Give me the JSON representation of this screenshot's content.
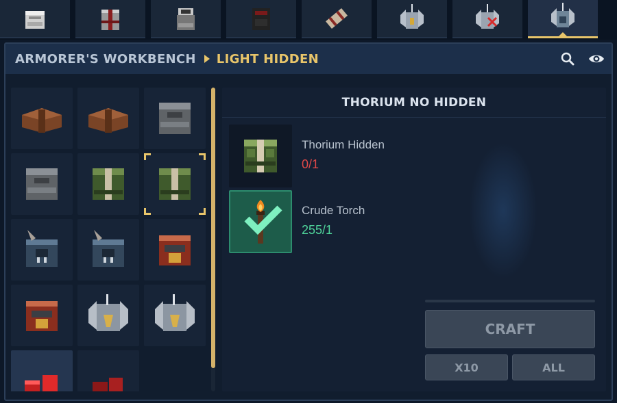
{
  "tabs": [
    {
      "name": "tab-chest-white",
      "icon": "white-armor-icon"
    },
    {
      "name": "tab-chest-red-trim",
      "icon": "red-trim-armor-icon"
    },
    {
      "name": "tab-chest-grey",
      "icon": "grey-armor-icon"
    },
    {
      "name": "tab-chest-dark",
      "icon": "dark-red-armor-icon"
    },
    {
      "name": "tab-scroll",
      "icon": "wrapped-scroll-icon"
    },
    {
      "name": "tab-winged-helm",
      "icon": "winged-helm-icon"
    },
    {
      "name": "tab-winged-helm-crossed",
      "icon": "winged-helm-crossed-icon"
    },
    {
      "name": "tab-winged-helm-active",
      "icon": "winged-helm-blue-icon",
      "active": true
    }
  ],
  "header": {
    "title": "ARMORER'S WORKBENCH",
    "subtitle": "LIGHT HIDDEN",
    "search_icon": "search-icon",
    "eye_icon": "eye-icon"
  },
  "recipes": [
    {
      "icon": "brown-leather-armor-icon",
      "color": "#8a5530"
    },
    {
      "icon": "brown-leather-armor-icon",
      "color": "#8a5530"
    },
    {
      "icon": "grey-plate-armor-icon",
      "color": "#6c7178"
    },
    {
      "icon": "grey-plate-armor-icon",
      "color": "#6c7178"
    },
    {
      "icon": "green-thorium-armor-icon",
      "color": "#4f6e3a"
    },
    {
      "icon": "green-thorium-armor-icon",
      "color": "#4f6e3a",
      "selected": true
    },
    {
      "icon": "blue-feathered-armor-icon",
      "color": "#3f566e"
    },
    {
      "icon": "blue-feathered-armor-icon",
      "color": "#3f566e"
    },
    {
      "icon": "red-gold-armor-icon",
      "color": "#9a3a28"
    },
    {
      "icon": "red-gold-armor-icon",
      "color": "#9a3a28"
    },
    {
      "icon": "silver-winged-armor-icon",
      "color": "#8c96a2"
    },
    {
      "icon": "silver-winged-armor-icon",
      "color": "#8c96a2"
    },
    {
      "icon": "red-boots-icon",
      "color": "#c02222",
      "hovered": true
    },
    {
      "icon": "red-boots-icon",
      "color": "#a01c1c"
    }
  ],
  "detail": {
    "title": "THORIUM NO HIDDEN",
    "ingredients": [
      {
        "name": "Thorium Hidden",
        "count": "0/1",
        "status": "missing",
        "icon": "green-thorium-armor-icon"
      },
      {
        "name": "Crude Torch",
        "count": "255/1",
        "status": "ok",
        "icon": "torch-icon"
      }
    ],
    "craft_label": "CRAFT",
    "x10_label": "X10",
    "all_label": "ALL"
  },
  "colors": {
    "accent": "#e8c56a",
    "ok": "#4fd39a",
    "missing": "#e04848",
    "panel": "#111d2e"
  }
}
